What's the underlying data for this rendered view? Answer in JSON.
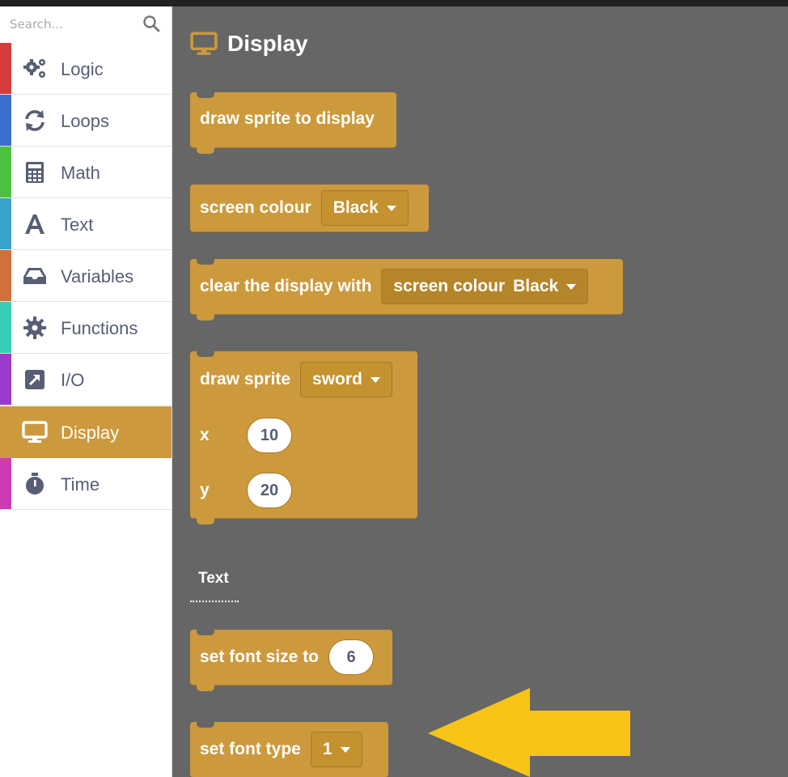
{
  "sidebar": {
    "search_placeholder": "Search...",
    "categories": [
      {
        "label": "Logic",
        "icon": "gears-icon",
        "color": "#d63c3c"
      },
      {
        "label": "Loops",
        "icon": "refresh-icon",
        "color": "#3a6fd0"
      },
      {
        "label": "Math",
        "icon": "calculator-icon",
        "color": "#4cc23e"
      },
      {
        "label": "Text",
        "icon": "letter-a-icon",
        "color": "#3aa3cc"
      },
      {
        "label": "Variables",
        "icon": "inbox-icon",
        "color": "#d0703a"
      },
      {
        "label": "Functions",
        "icon": "gear-icon",
        "color": "#3acdb6"
      },
      {
        "label": "I/O",
        "icon": "external-link-icon",
        "color": "#9b3acd"
      },
      {
        "label": "Display",
        "icon": "monitor-icon",
        "color": "#cc9a3c",
        "selected": true
      },
      {
        "label": "Time",
        "icon": "stopwatch-icon",
        "color": "#cd3ab6"
      }
    ]
  },
  "flyout": {
    "title": "Display",
    "title_icon": "monitor-icon",
    "blocks": {
      "draw_sprite_to_display": "draw sprite to display",
      "screen_colour": {
        "label": "screen colour",
        "value": "Black"
      },
      "clear_display": {
        "label": "clear the display with",
        "inner_label": "screen colour",
        "inner_value": "Black"
      },
      "draw_sprite": {
        "label": "draw sprite",
        "sprite": "sword",
        "x_label": "x",
        "x_value": "10",
        "y_label": "y",
        "y_value": "20"
      },
      "set_font_size": {
        "label": "set font size to",
        "value": "6"
      },
      "set_font_type": {
        "label": "set font type",
        "value": "1"
      }
    },
    "section_label": "Text"
  },
  "colors": {
    "block": "#cc9a3c",
    "workspace": "#666666",
    "arrow": "#f7c417"
  }
}
